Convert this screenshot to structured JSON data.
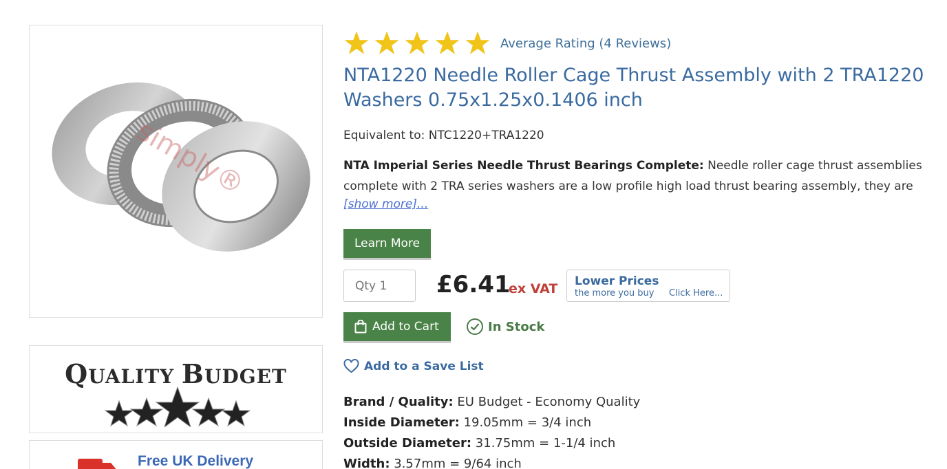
{
  "rating": {
    "stars": 5,
    "text": "Average Rating (4 Reviews)",
    "star_color": "#f0c419"
  },
  "product": {
    "title": "NTA1220 Needle Roller Cage Thrust Assembly with 2 TRA1220 Washers 0.75x1.25x0.1406 inch",
    "equivalent": "Equivalent to: NTC1220+TRA1220",
    "description_lead": "NTA Imperial Series Needle Thrust Bearings Complete:",
    "description_body": " Needle roller cage thrust assemblies complete with 2 TRA series washers are a low profile high load thrust bearing assembly, they are",
    "show_more": "[show more]...",
    "image_watermark": "simply®"
  },
  "buttons": {
    "learn_more": "Learn More",
    "add_to_cart": "Add to Cart",
    "save_list": "Add to a Save List"
  },
  "purchase": {
    "qty_placeholder": "Qty 1",
    "price": "£6.41",
    "ex_vat": "ex VAT",
    "lower_prices_title": "Lower Prices",
    "lower_prices_sub": "the more you buy",
    "lower_prices_click": "Click Here...",
    "stock_status": "In Stock"
  },
  "badges": {
    "quality_q": "Q",
    "quality_rest": "UALITY ",
    "quality_b": "B",
    "quality_rest2": "UDGET",
    "delivery": "Free UK Delivery"
  },
  "specs": [
    {
      "label": "Brand / Quality:",
      "value": " EU Budget - Economy Quality"
    },
    {
      "label": "Inside Diameter:",
      "value": " 19.05mm = 3/4 inch"
    },
    {
      "label": "Outside Diameter:",
      "value": " 31.75mm = 1-1/4 inch"
    },
    {
      "label": "Width:",
      "value": " 3.57mm = 9/64 inch"
    }
  ],
  "colors": {
    "accent_green": "#4a8347",
    "title_blue": "#3a6aa0",
    "vat_red": "#c0403a"
  }
}
